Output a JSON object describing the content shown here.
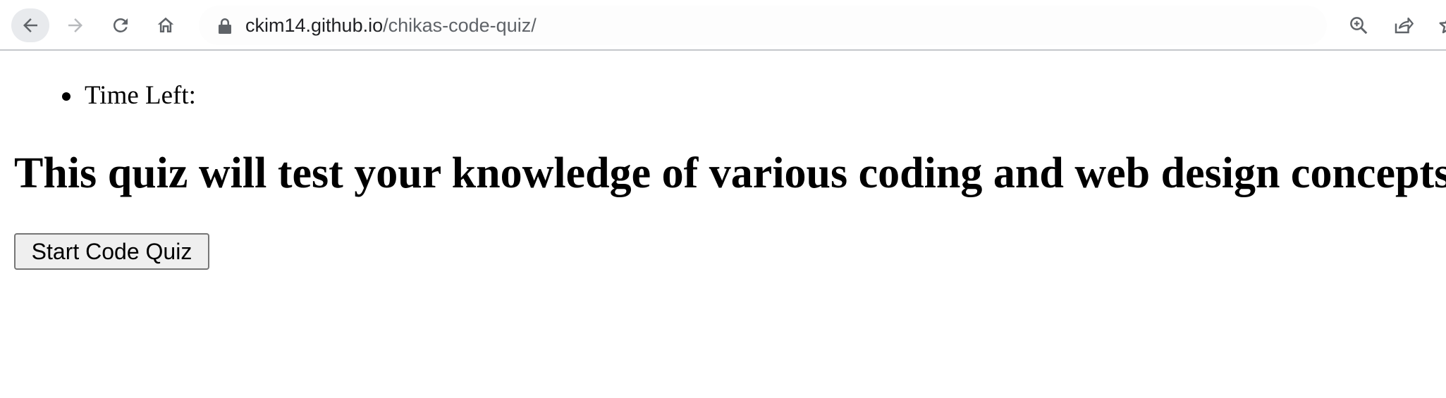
{
  "browser": {
    "url_host": "ckim14.github.io",
    "url_path": "/chikas-code-quiz/",
    "icons": {
      "back": "back-arrow-icon",
      "forward": "forward-arrow-icon",
      "reload": "reload-icon",
      "home": "home-icon",
      "lock": "lock-icon",
      "zoom": "zoom-icon",
      "share": "share-icon",
      "bookmark": "bookmark-star-icon"
    }
  },
  "page": {
    "timer_label": "Time Left:",
    "heading": "This quiz will test your knowledge of various coding and web design concepts",
    "start_button_label": "Start Code Quiz"
  }
}
